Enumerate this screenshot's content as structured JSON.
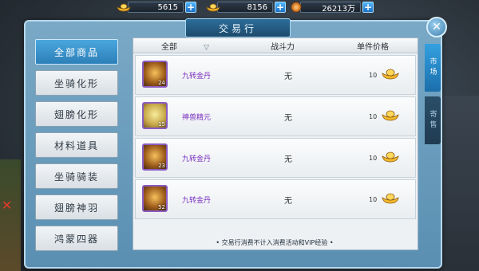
{
  "currencies": [
    {
      "icon": "gold-ingot-icon",
      "value": "5615"
    },
    {
      "icon": "gold-ingot-icon",
      "value": "8156"
    },
    {
      "icon": "coin-icon",
      "value": "26213万"
    }
  ],
  "window": {
    "title": "交易行"
  },
  "sidebar": {
    "items": [
      {
        "label": "全部商品",
        "active": true
      },
      {
        "label": "坐骑化形",
        "active": false
      },
      {
        "label": "翅膀化形",
        "active": false
      },
      {
        "label": "材料道具",
        "active": false
      },
      {
        "label": "坐骑骑装",
        "active": false
      },
      {
        "label": "翅膀神羽",
        "active": false
      },
      {
        "label": "鸿蒙四器",
        "active": false
      }
    ]
  },
  "table": {
    "headers": {
      "filter": "全部",
      "power": "战斗力",
      "price": "单件价格"
    },
    "rows": [
      {
        "name": "九转金丹",
        "count": "24",
        "power": "无",
        "price": "10",
        "icon": "golden-pill-icon"
      },
      {
        "name": "神兽精元",
        "count": "15",
        "power": "无",
        "price": "10",
        "icon": "beast-essence-icon"
      },
      {
        "name": "九转金丹",
        "count": "23",
        "power": "无",
        "price": "10",
        "icon": "golden-pill-icon"
      },
      {
        "name": "九转金丹",
        "count": "52",
        "power": "无",
        "price": "10",
        "icon": "golden-pill-icon"
      }
    ]
  },
  "footer_note": "• 交易行消费不计入消费活动和VIP经验 •",
  "right_tabs": [
    {
      "label": "市场",
      "active": true
    },
    {
      "label": "寄售",
      "active": false
    }
  ],
  "colors": {
    "accent": "#2c7fb8",
    "item_name": "#7a2fbf",
    "border_rare": "#8b5cc0"
  }
}
